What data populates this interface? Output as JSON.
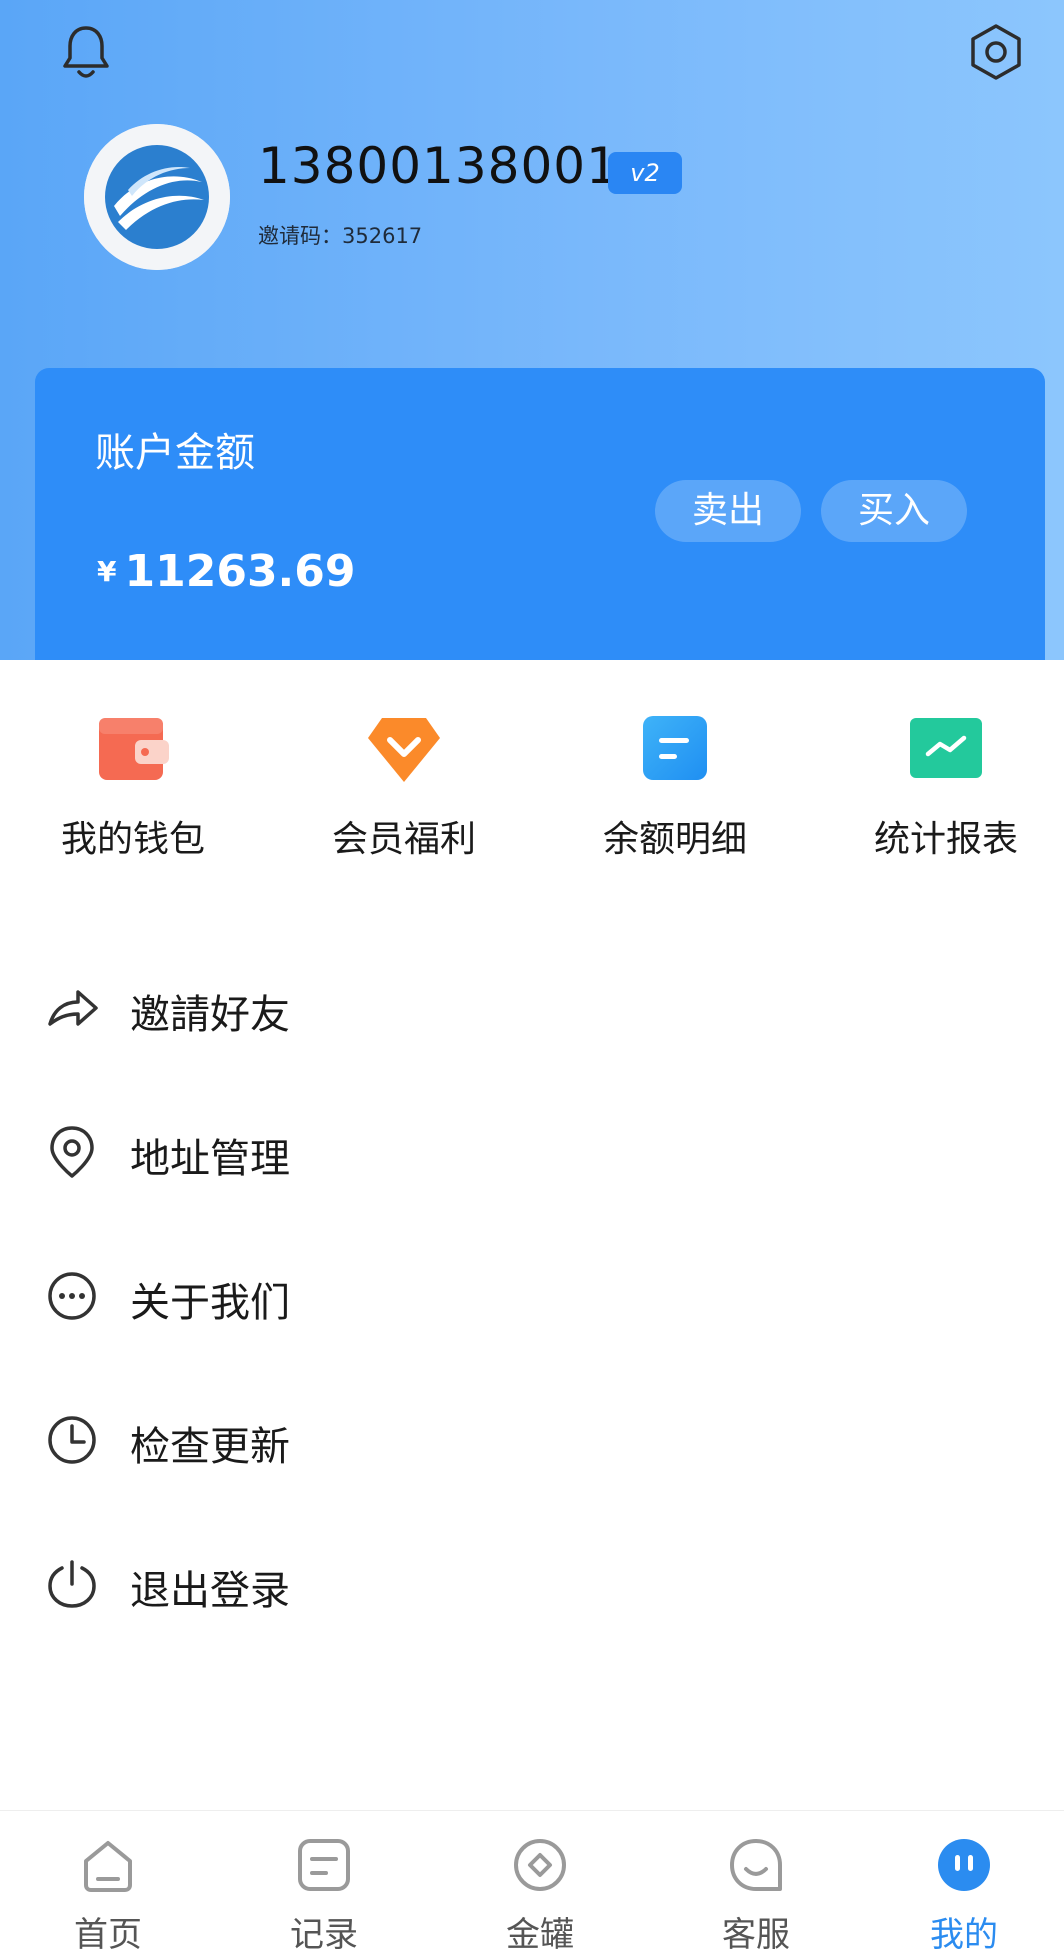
{
  "profile": {
    "phone": "13800138001",
    "level_badge": "v2",
    "invite_code": "邀请码：352617"
  },
  "header": {
    "bell_icon": "bell-icon",
    "settings_icon": "hexagon-gear-icon"
  },
  "balance": {
    "label": "账户金额",
    "currency": "¥",
    "value": "11263.69",
    "sell_label": "卖出",
    "buy_label": "买入"
  },
  "quick_actions": [
    {
      "label": "我的钱包",
      "icon": "wallet-icon",
      "color": "#f56a52"
    },
    {
      "label": "会员福利",
      "icon": "diamond-icon",
      "color": "#fb8a2a"
    },
    {
      "label": "余额明细",
      "icon": "list-card-icon",
      "color": "#27a7f5"
    },
    {
      "label": "统计报表",
      "icon": "chart-card-icon",
      "color": "#23c99c"
    }
  ],
  "menu": [
    {
      "label": "邀請好友",
      "icon": "share-arrow-icon"
    },
    {
      "label": "地址管理",
      "icon": "location-pin-icon"
    },
    {
      "label": "关于我们",
      "icon": "more-dots-icon"
    },
    {
      "label": "检查更新",
      "icon": "clock-icon"
    },
    {
      "label": "退出登录",
      "icon": "power-icon"
    }
  ],
  "tabbar": [
    {
      "label": "首页",
      "icon": "home-icon"
    },
    {
      "label": "记录",
      "icon": "record-icon"
    },
    {
      "label": "金罐",
      "icon": "jar-icon"
    },
    {
      "label": "客服",
      "icon": "service-icon"
    },
    {
      "label": "我的",
      "icon": "mine-icon",
      "active": true
    }
  ],
  "colors": {
    "header_gradient_start": "#5aa6f7",
    "header_gradient_end": "#8cc6fd",
    "card_blue": "#2e8df8",
    "accent": "#2b8cf0"
  }
}
